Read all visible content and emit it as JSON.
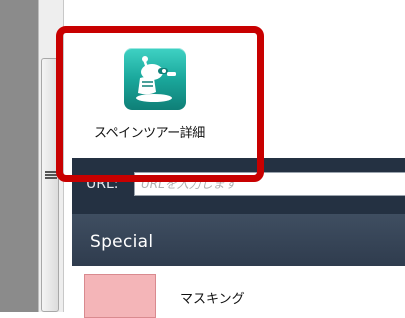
{
  "app": {
    "label": "スペインツアー詳細",
    "icon": "snail-robot-icon",
    "tile_color": "#1aa79b"
  },
  "url_bar": {
    "label": "URL:",
    "placeholder": "URLを入力します"
  },
  "section": {
    "title": "Special"
  },
  "list": {
    "items": [
      {
        "label": "マスキング",
        "swatch_color": "#f4b5b8"
      }
    ]
  },
  "annotation": {
    "highlight_color": "#c80000"
  }
}
